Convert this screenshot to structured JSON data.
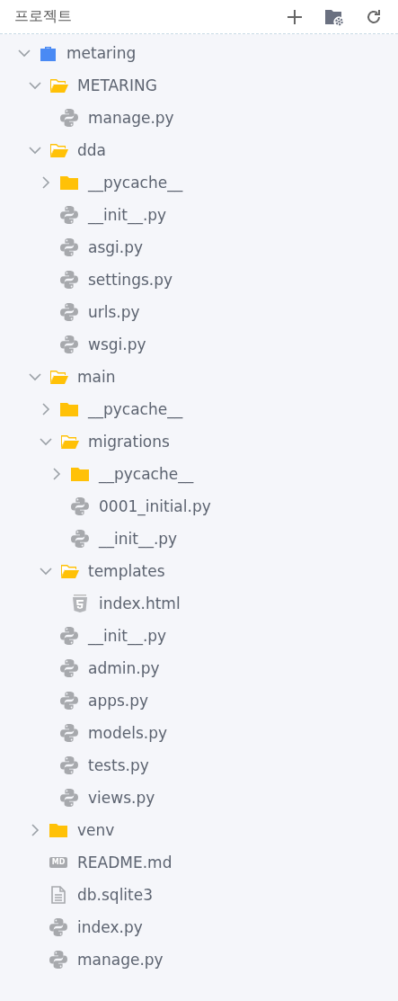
{
  "header": {
    "title": "프로젝트"
  },
  "tree": [
    {
      "kind": "project",
      "name": "metaring",
      "expanded": true,
      "children": [
        {
          "kind": "folder",
          "name": "METARING",
          "expanded": true,
          "children": [
            {
              "kind": "python",
              "name": "manage.py"
            }
          ]
        },
        {
          "kind": "folder",
          "name": "dda",
          "expanded": true,
          "children": [
            {
              "kind": "folder",
              "name": "__pycache__",
              "expanded": false
            },
            {
              "kind": "python",
              "name": "__init__.py"
            },
            {
              "kind": "python",
              "name": "asgi.py"
            },
            {
              "kind": "python",
              "name": "settings.py"
            },
            {
              "kind": "python",
              "name": "urls.py"
            },
            {
              "kind": "python",
              "name": "wsgi.py"
            }
          ]
        },
        {
          "kind": "folder",
          "name": "main",
          "expanded": true,
          "children": [
            {
              "kind": "folder",
              "name": "__pycache__",
              "expanded": false
            },
            {
              "kind": "folder",
              "name": "migrations",
              "expanded": true,
              "children": [
                {
                  "kind": "folder",
                  "name": "__pycache__",
                  "expanded": false
                },
                {
                  "kind": "python",
                  "name": "0001_initial.py"
                },
                {
                  "kind": "python",
                  "name": "__init__.py"
                }
              ]
            },
            {
              "kind": "folder",
              "name": "templates",
              "expanded": true,
              "children": [
                {
                  "kind": "html",
                  "name": "index.html"
                }
              ]
            },
            {
              "kind": "python",
              "name": "__init__.py"
            },
            {
              "kind": "python",
              "name": "admin.py"
            },
            {
              "kind": "python",
              "name": "apps.py"
            },
            {
              "kind": "python",
              "name": "models.py"
            },
            {
              "kind": "python",
              "name": "tests.py"
            },
            {
              "kind": "python",
              "name": "views.py"
            }
          ]
        },
        {
          "kind": "folder",
          "name": "venv",
          "expanded": false
        },
        {
          "kind": "markdown",
          "name": "README.md",
          "badge": "MD"
        },
        {
          "kind": "text",
          "name": "db.sqlite3"
        },
        {
          "kind": "python",
          "name": "index.py"
        },
        {
          "kind": "python",
          "name": "manage.py"
        }
      ]
    }
  ]
}
